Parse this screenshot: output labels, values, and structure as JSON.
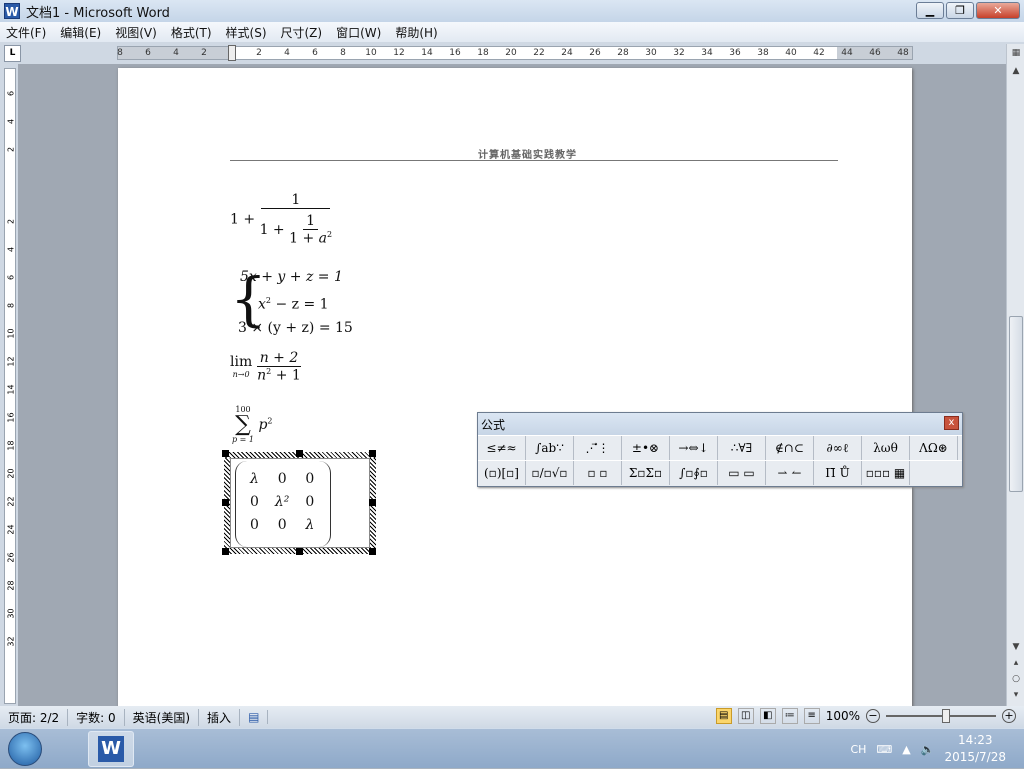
{
  "window": {
    "title": "文档1 - Microsoft Word",
    "app_icon": "W"
  },
  "menu": [
    "文件(F)",
    "编辑(E)",
    "视图(V)",
    "格式(T)",
    "样式(S)",
    "尺寸(Z)",
    "窗口(W)",
    "帮助(H)"
  ],
  "ruler": {
    "tab_selector": "L",
    "left": [
      "8",
      "6",
      "4",
      "2"
    ],
    "right": [
      "2",
      "4",
      "6",
      "8",
      "10",
      "12",
      "14",
      "16",
      "18",
      "20",
      "22",
      "24",
      "26",
      "28",
      "30",
      "32",
      "34",
      "36",
      "38",
      "40",
      "42",
      "44",
      "46",
      "48"
    ],
    "vertical": [
      "6",
      "4",
      "2",
      "2",
      "4",
      "6",
      "8",
      "10",
      "12",
      "14",
      "16",
      "18",
      "20",
      "22",
      "24",
      "26",
      "28",
      "30",
      "32"
    ]
  },
  "document": {
    "header": "计算机基础实践教学",
    "eq1": {
      "one": "1",
      "plus": "+",
      "num": "1",
      "inner_one": "1",
      "inner_num": "1",
      "inner_den": "1 + ",
      "a": "a",
      "exp": "2"
    },
    "eq2": {
      "row1": "5x + y + z  = 1",
      "row2_x": "x",
      "row2_exp": "2",
      "row2_rest": " − z  = 1",
      "row3": "3 × (y + z) = 15"
    },
    "eq3": {
      "lim": "lim",
      "sub": "n→0",
      "num": "n + 2",
      "den_n": "n",
      "den_exp": "2",
      "den_rest": " + 1"
    },
    "eq4": {
      "upper": "100",
      "sigma": "∑",
      "lower": "p = 1",
      "p": "p",
      "exp": "2"
    },
    "eq5": {
      "cells": [
        [
          "λ",
          "0",
          "0"
        ],
        [
          "0",
          "λ²",
          "0"
        ],
        [
          "0",
          "0",
          "λ"
        ]
      ]
    }
  },
  "palette": {
    "title": "公式",
    "close": "x",
    "row1": [
      "≤≠≈",
      "∫ab∵",
      "⋰⃗⋮",
      "±•⊗",
      "→⇔↓",
      "∴∀∃",
      "∉∩⊂",
      "∂∞ℓ",
      "λωθ",
      "ΛΩ⊛"
    ],
    "row2": [
      "(▫)[▫]",
      "▫/▫√▫",
      "▫ ▫",
      "Σ▫Σ▫",
      "∫▫∮▫",
      "▭ ▭",
      "⇀ ↼",
      "Π̄ Ů",
      "▫▫▫ ▦"
    ]
  },
  "status": {
    "page": "页面: 2/2",
    "words": "字数: 0",
    "lang": "英语(美国)",
    "mode": "插入",
    "zoom": "100%",
    "zoom_minus": "−",
    "zoom_plus": "+",
    "zoom_level_percent": 100
  },
  "taskbar": {
    "ime": "CH",
    "time": "14:23",
    "date": "2015/7/28",
    "word_icon": "W"
  }
}
